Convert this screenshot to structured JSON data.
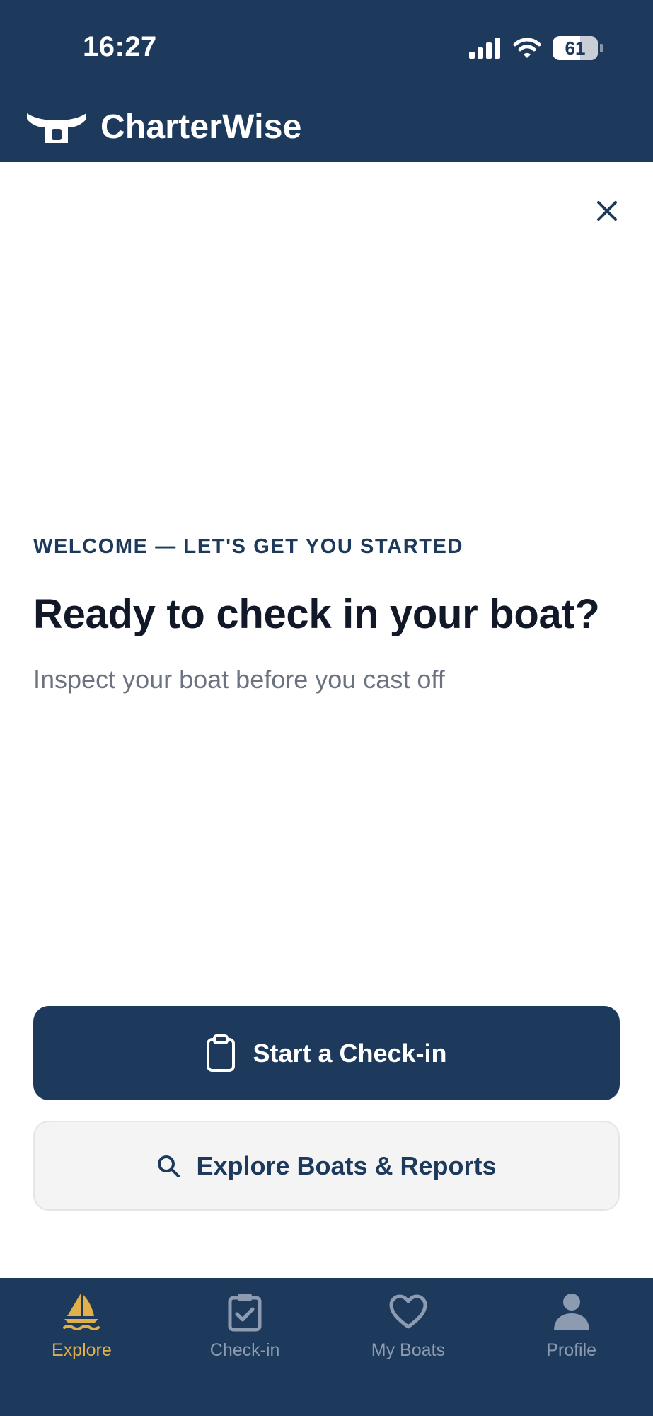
{
  "status_bar": {
    "time": "16:27",
    "battery_level": "61",
    "icons": [
      "cellular-signal-icon",
      "wifi-icon",
      "battery-icon"
    ]
  },
  "header": {
    "app_name": "CharterWise",
    "logo_icon": "boat-cleat-icon"
  },
  "close_icon": "close-icon",
  "welcome": {
    "eyebrow": "WELCOME — LET'S GET YOU STARTED",
    "title": "Ready to check in your boat?",
    "subtitle": "Inspect your boat before you cast off"
  },
  "actions": {
    "primary": {
      "label": "Start a Check-in",
      "icon": "clipboard-icon"
    },
    "secondary": {
      "label": "Explore Boats & Reports",
      "icon": "search-icon"
    }
  },
  "tabs": [
    {
      "label": "Explore",
      "icon": "sailboat-icon",
      "active": true
    },
    {
      "label": "Check-in",
      "icon": "clipboard-check-icon",
      "active": false
    },
    {
      "label": "My Boats",
      "icon": "heart-icon",
      "active": false
    },
    {
      "label": "Profile",
      "icon": "person-icon",
      "active": false
    }
  ],
  "colors": {
    "brand_navy": "#1d3a5c",
    "active_tab": "#e2b04a",
    "inactive_tab": "#8c9bb0",
    "secondary_button_bg": "#f4f4f5",
    "subtitle_gray": "#6b7280"
  }
}
